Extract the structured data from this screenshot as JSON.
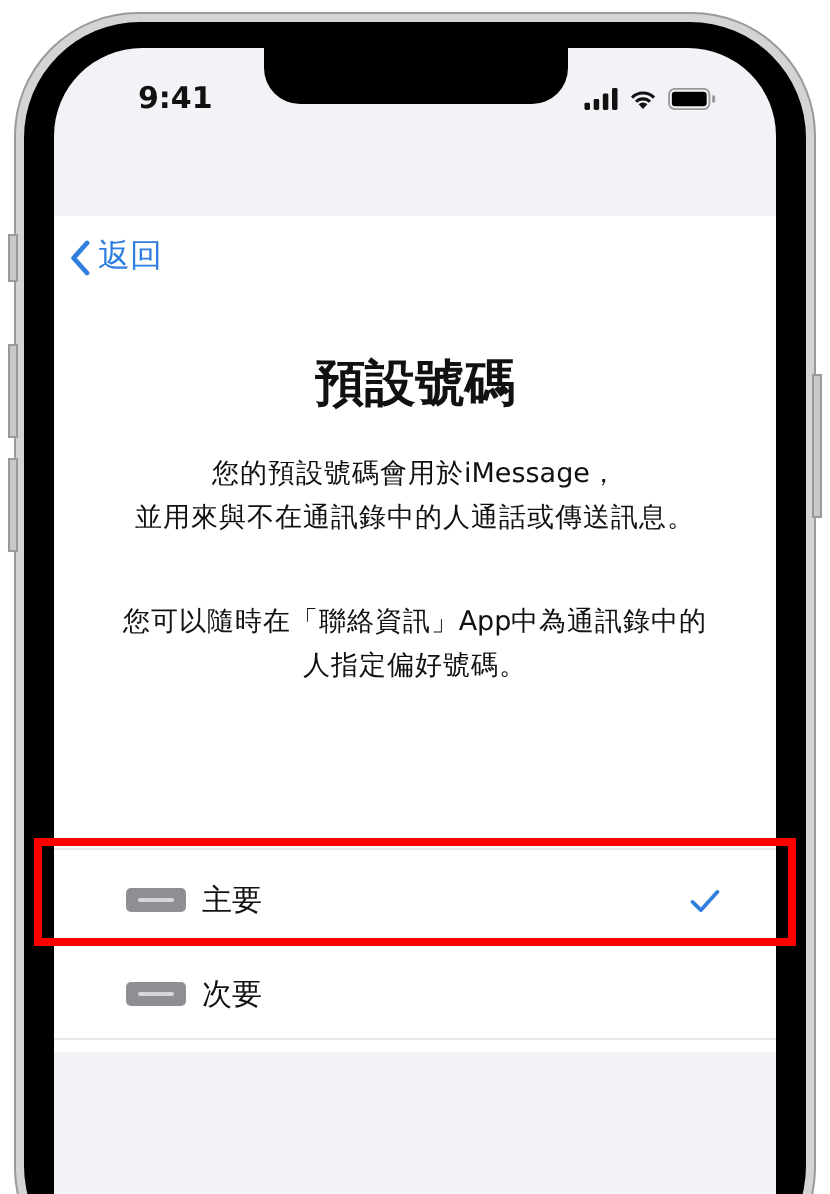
{
  "status_bar": {
    "time": "9:41"
  },
  "nav": {
    "back": "返回"
  },
  "title": "預設號碼",
  "paragraphs": [
    {
      "lines": [
        "您的預設號碼會用於iMessage，",
        "並用來與不在通訊錄中的人通話或傳送訊息。"
      ]
    },
    {
      "lines": [
        "您可以隨時在「聯絡資訊」App中為通訊錄中的",
        "人指定偏好號碼。"
      ]
    }
  ],
  "options": [
    {
      "label": "主要",
      "selected": true,
      "highlighted": true
    },
    {
      "label": "次要",
      "selected": false,
      "highlighted": false
    }
  ]
}
